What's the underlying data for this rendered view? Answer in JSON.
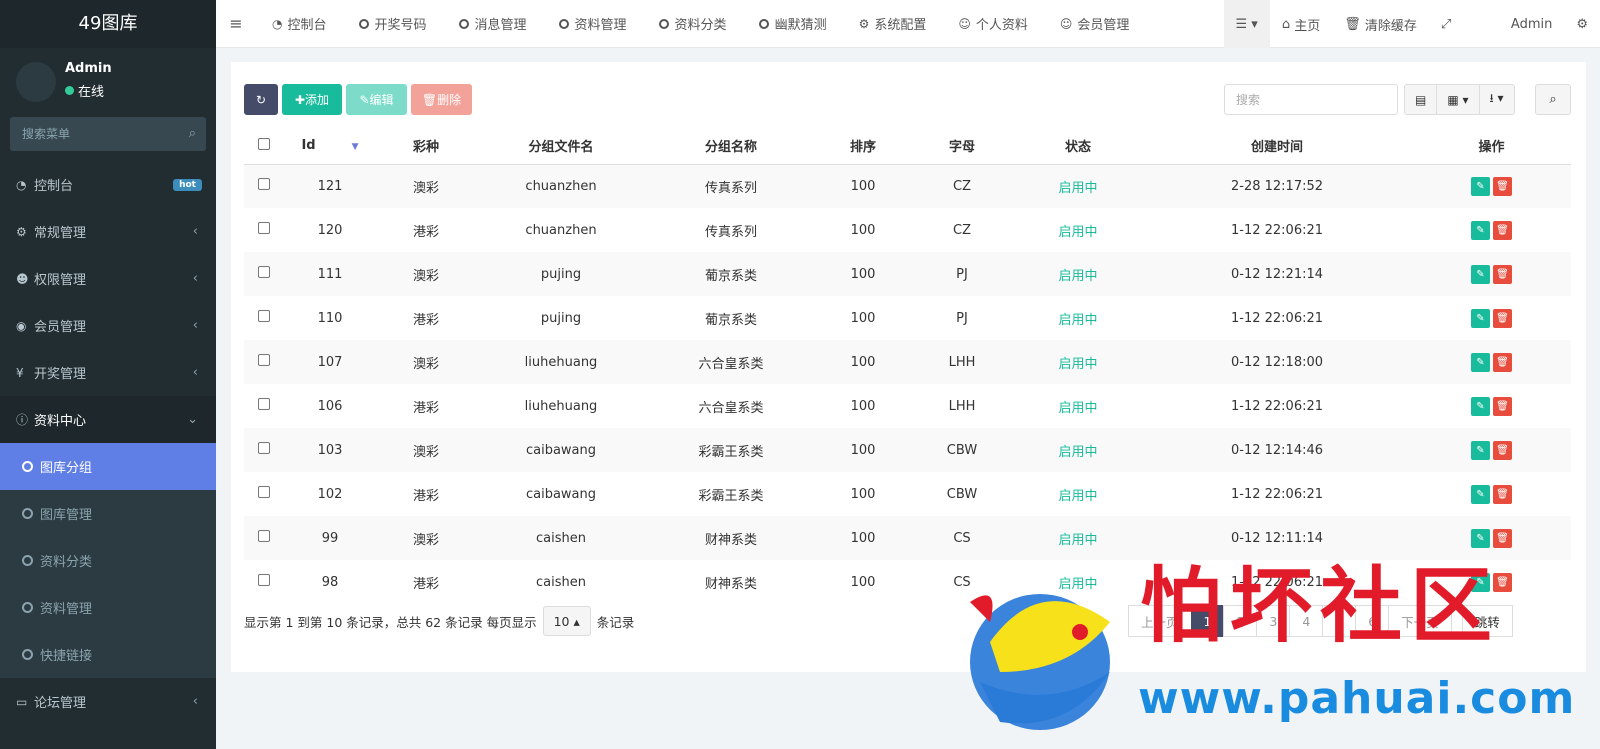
{
  "sidebar": {
    "logo": "49图库",
    "user_name": "Admin",
    "user_status": "在线",
    "search_placeholder": "搜索菜单",
    "hot_badge": "hot",
    "items": [
      {
        "label": "控制台",
        "icon": "dashboard-icon"
      },
      {
        "label": "常规管理",
        "icon": "cogs-icon"
      },
      {
        "label": "权限管理",
        "icon": "users-icon"
      },
      {
        "label": "会员管理",
        "icon": "user-circle-icon"
      },
      {
        "label": "开奖管理",
        "icon": "yen-icon"
      },
      {
        "label": "资料中心",
        "icon": "info-circle-icon"
      }
    ],
    "sub_items": [
      {
        "label": "图库分组"
      },
      {
        "label": "图库管理"
      },
      {
        "label": "资料分类"
      },
      {
        "label": "资料管理"
      },
      {
        "label": "快捷链接"
      }
    ],
    "forum": {
      "label": "论坛管理",
      "icon": "laptop-icon"
    }
  },
  "topbar": {
    "nav": [
      {
        "label": "控制台",
        "icon": "dashboard-icon"
      },
      {
        "label": "开奖号码",
        "icon": "circle-icon"
      },
      {
        "label": "消息管理",
        "icon": "circle-icon"
      },
      {
        "label": "资料管理",
        "icon": "circle-icon"
      },
      {
        "label": "资料分类",
        "icon": "circle-icon"
      },
      {
        "label": "幽默猜测",
        "icon": "circle-icon"
      },
      {
        "label": "系统配置",
        "icon": "gear-icon"
      },
      {
        "label": "个人资料",
        "icon": "user-icon"
      },
      {
        "label": "会员管理",
        "icon": "user-icon"
      }
    ],
    "home": "主页",
    "clear_cache": "清除缓存",
    "admin": "Admin"
  },
  "toolbar": {
    "add": "添加",
    "edit": "编辑",
    "delete": "删除",
    "search_placeholder": "搜索"
  },
  "table": {
    "headers": [
      "Id",
      "彩种",
      "分组文件名",
      "分组名称",
      "排序",
      "字母",
      "状态",
      "创建时间",
      "操作"
    ],
    "rows": [
      {
        "id": "121",
        "type": "澳彩",
        "file": "chuanzhen",
        "name": "传真系列",
        "sort": "100",
        "letter": "CZ",
        "status": "启用中",
        "time": "2-28 12:17:52"
      },
      {
        "id": "120",
        "type": "港彩",
        "file": "chuanzhen",
        "name": "传真系列",
        "sort": "100",
        "letter": "CZ",
        "status": "启用中",
        "time": "1-12 22:06:21"
      },
      {
        "id": "111",
        "type": "澳彩",
        "file": "pujing",
        "name": "葡京系类",
        "sort": "100",
        "letter": "PJ",
        "status": "启用中",
        "time": "0-12 12:21:14"
      },
      {
        "id": "110",
        "type": "港彩",
        "file": "pujing",
        "name": "葡京系类",
        "sort": "100",
        "letter": "PJ",
        "status": "启用中",
        "time": "1-12 22:06:21"
      },
      {
        "id": "107",
        "type": "澳彩",
        "file": "liuhehuang",
        "name": "六合皇系类",
        "sort": "100",
        "letter": "LHH",
        "status": "启用中",
        "time": "0-12 12:18:00"
      },
      {
        "id": "106",
        "type": "港彩",
        "file": "liuhehuang",
        "name": "六合皇系类",
        "sort": "100",
        "letter": "LHH",
        "status": "启用中",
        "time": "1-12 22:06:21"
      },
      {
        "id": "103",
        "type": "澳彩",
        "file": "caibawang",
        "name": "彩霸王系类",
        "sort": "100",
        "letter": "CBW",
        "status": "启用中",
        "time": "0-12 12:14:46"
      },
      {
        "id": "102",
        "type": "港彩",
        "file": "caibawang",
        "name": "彩霸王系类",
        "sort": "100",
        "letter": "CBW",
        "status": "启用中",
        "time": "1-12 22:06:21"
      },
      {
        "id": "99",
        "type": "澳彩",
        "file": "caishen",
        "name": "财神系类",
        "sort": "100",
        "letter": "CS",
        "status": "启用中",
        "time": "0-12 12:11:14"
      },
      {
        "id": "98",
        "type": "港彩",
        "file": "caishen",
        "name": "财神系类",
        "sort": "100",
        "letter": "CS",
        "status": "启用中",
        "time": "1-12 22:06:21"
      }
    ]
  },
  "footer": {
    "info_prefix": "显示第 1 到第 10 条记录，总共 62 条记录 每页显示",
    "page_size": "10",
    "info_suffix": "条记录",
    "pager": [
      "上一页",
      "1",
      "2",
      "3",
      "4",
      "5",
      "6",
      "下一页"
    ],
    "jump": "跳转"
  },
  "watermark": {
    "title": "怕坏社区",
    "url": "www.pahuai.com"
  }
}
